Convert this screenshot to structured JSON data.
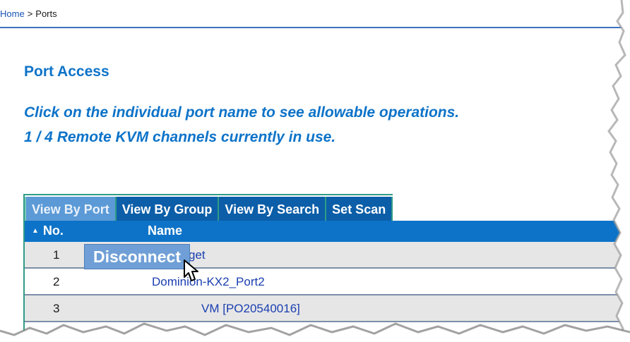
{
  "breadcrumb": {
    "home": "Home",
    "separator": ">",
    "current": "Ports"
  },
  "page": {
    "title": "Port Access",
    "info_line1": "Click on the individual port name to see allowable operations.",
    "info_line2": "1 / 4 Remote KVM channels currently in use."
  },
  "tabs": [
    {
      "label": "View By Port",
      "active": true
    },
    {
      "label": "View By Group",
      "active": false
    },
    {
      "label": "View By Search",
      "active": false
    },
    {
      "label": "Set Scan",
      "active": false
    }
  ],
  "table": {
    "headers": {
      "no": "No.",
      "name": "Name"
    },
    "sort_icon": "sort-ascending-icon",
    "rows": [
      {
        "no": "1",
        "name": "get"
      },
      {
        "no": "2",
        "name": "Dominion-KX2_Port2"
      },
      {
        "no": "3",
        "name": "VM [PO20540016]"
      }
    ]
  },
  "popup": {
    "label": "Disconnect"
  },
  "colors": {
    "accent": "#0d73c8",
    "tab_bg": "#0c5ea8",
    "tab_active_bg": "#5b9ad6",
    "tab_border": "#2e9c86",
    "popup_bg": "#6f9fd6"
  }
}
